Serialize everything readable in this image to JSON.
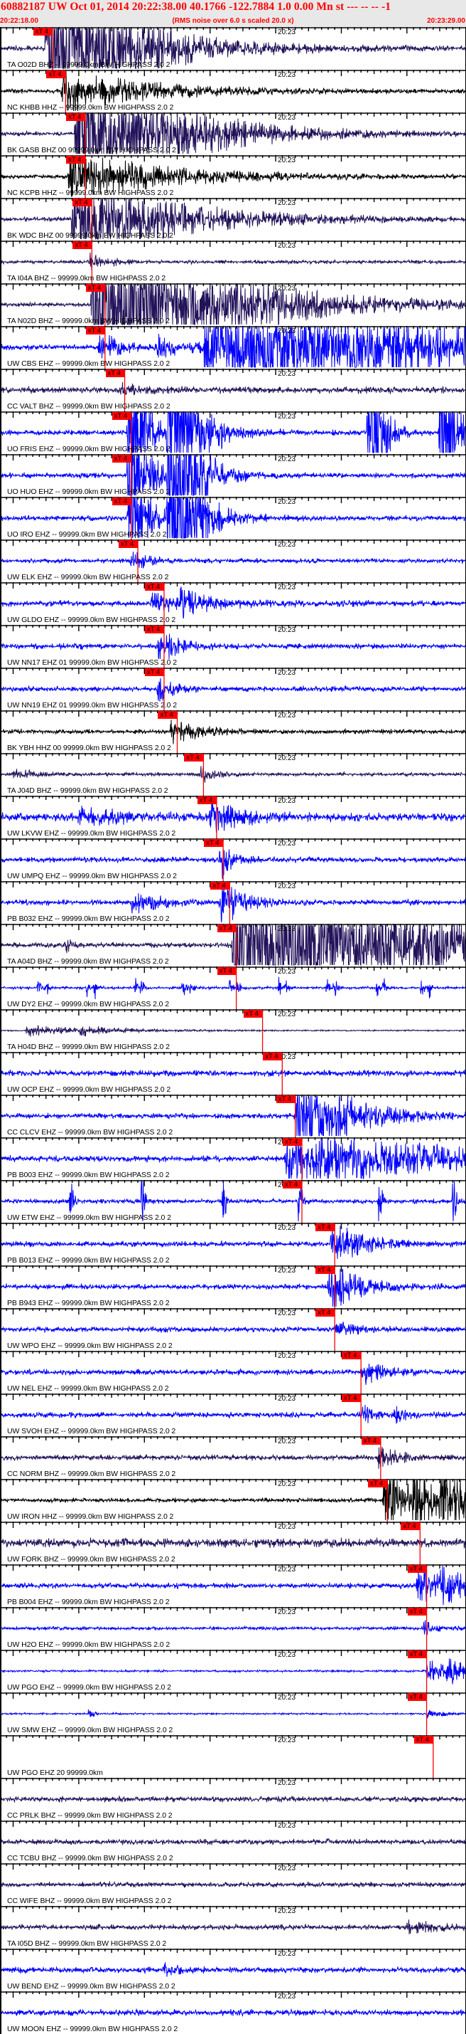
{
  "header": {
    "title": "60882187 UW Oct 01, 2014 20:22:38.00    40.1766 -122.7884  1.0 0.00 Mn st --- -- --  -1",
    "start_time": "20:22:18.00",
    "note": "(RMS noise over 6.0 s scaled 20.0 x)",
    "end_time": "20:23:29.00"
  },
  "colors": {
    "navy": "#22125a",
    "black": "#000000",
    "blue": "#0000ff",
    "pick": "#ff0000",
    "header_bg": "#e8e8e8"
  },
  "chart_data": {
    "type": "line",
    "title": "60882187 UW Oct 01, 2014 20:22:38.00",
    "x_range_s": [
      0,
      71
    ],
    "x_start": "20:22:18.00",
    "x_end": "20:23:29.00",
    "minute_mark_label": "20:23",
    "minute_mark_s": 42,
    "pick_label": "xT 4",
    "traces": [
      {
        "label": "TA O02D BHZ -- 99999.0km BW  HIGHPASS  2.0  2",
        "color": "navy",
        "noise": 0.12,
        "pick_s": 8,
        "events": [
          [
            7,
            6,
            10
          ]
        ]
      },
      {
        "label": "NC KHBB HHZ -- 99999.0km BW  HIGHPASS  2.0  2",
        "color": "black",
        "noise": 0.1,
        "pick_s": 10,
        "events": [
          [
            9.5,
            1.2,
            12
          ]
        ]
      },
      {
        "label": "BK GASB BHZ 00 99999.0km BW  HIGHPASS  2.0  2",
        "color": "navy",
        "noise": 0.1,
        "pick_s": 13,
        "events": [
          [
            11.5,
            5,
            12
          ]
        ]
      },
      {
        "label": "NC KCPB HHZ -- 99999.0km BW  HIGHPASS  2.0  2",
        "color": "black",
        "noise": 0.1,
        "pick_s": 13,
        "events": [
          [
            10.5,
            1.3,
            14
          ]
        ]
      },
      {
        "label": "BK WDC BHZ 00 99999.0km BW  HIGHPASS  2.0  2",
        "color": "navy",
        "noise": 0.1,
        "pick_s": 14,
        "events": [
          [
            11,
            2.5,
            14
          ]
        ]
      },
      {
        "label": "TA I04A BHZ -- 99999.0km BW  HIGHPASS  2.0  2",
        "color": "navy",
        "noise": 0.08,
        "pick_s": 14,
        "events": [
          [
            13.5,
            0.6,
            1.5
          ],
          [
            17,
            0.15,
            2
          ]
        ]
      },
      {
        "label": "TA N02D BHZ -- 99999.0km BW  HIGHPASS  2.0  2",
        "color": "navy",
        "noise": 0.1,
        "pick_s": 16,
        "events": [
          [
            14,
            6,
            15
          ]
        ]
      },
      {
        "label": "UW CBS EHZ -- 99999.0km BW  HIGHPASS  2.0  2",
        "color": "blue",
        "noise": 0.12,
        "pick_s": 16,
        "events": [
          [
            15,
            1.0,
            2.5
          ],
          [
            24,
            0.6,
            5
          ],
          [
            31,
            3,
            40
          ]
        ]
      },
      {
        "label": "CC VALT BHZ -- 99999.0km BW  HIGHPASS  2.0  2",
        "color": "navy",
        "noise": 0.15,
        "pick_s": 19,
        "events": [
          [
            18.5,
            0.4,
            2
          ]
        ]
      },
      {
        "label": "UO FRIS EHZ -- 99999.0km BW  HIGHPASS  2.0  2",
        "color": "blue",
        "noise": 0.12,
        "pick_s": 20,
        "events": [
          [
            19.5,
            6,
            2
          ],
          [
            25.5,
            10,
            3
          ],
          [
            56,
            10,
            1.5
          ],
          [
            67,
            10,
            1.5
          ]
        ]
      },
      {
        "label": "UO HUO EHZ -- 99999.0km BW  HIGHPASS  2.0  2",
        "color": "blue",
        "noise": 0.12,
        "pick_s": 20,
        "events": [
          [
            19.5,
            6,
            2
          ],
          [
            25.5,
            10,
            3
          ]
        ]
      },
      {
        "label": "UO IRO EHZ -- 99999.0km BW  HIGHPASS  2.0  2",
        "color": "blue",
        "noise": 0.12,
        "pick_s": 20,
        "events": [
          [
            19.5,
            6,
            2
          ],
          [
            25.5,
            10,
            3
          ]
        ]
      },
      {
        "label": "UW ELK EHZ -- 99999.0km BW  HIGHPASS  2.0  2",
        "color": "blue",
        "noise": 0.1,
        "pick_s": 21,
        "events": [
          [
            20,
            0.45,
            3
          ]
        ]
      },
      {
        "label": "UW GLDO EHZ -- 99999.0km BW  HIGHPASS  2.0  2",
        "color": "blue",
        "noise": 0.13,
        "pick_s": 25,
        "events": [
          [
            23,
            0.5,
            6
          ],
          [
            27,
            0.6,
            4
          ]
        ]
      },
      {
        "label": "UW NN17 EHZ 01 99999.0km BW  HIGHPASS  2.0  2",
        "color": "blue",
        "noise": 0.12,
        "pick_s": 25,
        "events": [
          [
            24,
            0.9,
            3
          ]
        ]
      },
      {
        "label": "UW NN19 EHZ 01 99999.0km BW  HIGHPASS  2.0  2",
        "color": "blue",
        "noise": 0.12,
        "pick_s": 25,
        "events": [
          [
            24,
            0.8,
            2
          ]
        ]
      },
      {
        "label": "BK YBH HHZ 00 99999.0km BW  HIGHPASS  2.0  2",
        "color": "black",
        "noise": 0.1,
        "pick_s": 27,
        "events": [
          [
            26,
            0.7,
            4
          ]
        ]
      },
      {
        "label": "TA J04D BHZ -- 99999.0km BW  HIGHPASS  2.0  2",
        "color": "navy",
        "noise": 0.08,
        "pick_s": 31,
        "events": [
          [
            2,
            0.3,
            3
          ],
          [
            30.5,
            0.5,
            2
          ]
        ]
      },
      {
        "label": "UW LKVW EHZ -- 99999.0km BW  HIGHPASS  2.0  2",
        "color": "blue",
        "noise": 0.18,
        "pick_s": 33,
        "events": [
          [
            12,
            0.4,
            8
          ],
          [
            32,
            0.9,
            4
          ]
        ]
      },
      {
        "label": "UW UMPQ EHZ -- 99999.0km BW  HIGHPASS  2.0  2",
        "color": "blue",
        "noise": 0.12,
        "pick_s": 34,
        "events": [
          [
            33.5,
            1.2,
            1.5
          ]
        ]
      },
      {
        "label": "PB B032 EHZ -- 99999.0km BW  HIGHPASS  2.0  2",
        "color": "blue",
        "noise": 0.12,
        "pick_s": 35,
        "events": [
          [
            20,
            0.6,
            4
          ],
          [
            33.5,
            1.5,
            3
          ]
        ]
      },
      {
        "label": "TA A04D BHZ -- 99999.0km BW  HIGHPASS  2.0  2",
        "color": "navy",
        "noise": 0.12,
        "pick_s": 36,
        "events": [
          [
            9.6,
            0.5,
            1
          ],
          [
            35.5,
            4,
            40
          ]
        ]
      },
      {
        "label": "UW DY2 EHZ -- 99999.0km BW  HIGHPASS  2.0  2",
        "color": "blue",
        "noise": 0.06,
        "pick_s": 36,
        "events": [
          [
            5.7,
            0.9,
            0.3
          ],
          [
            7,
            0.9,
            0.3
          ],
          [
            13.2,
            0.9,
            0.3
          ],
          [
            14.4,
            0.9,
            0.3
          ],
          [
            20.5,
            0.9,
            0.3
          ],
          [
            21.5,
            0.9,
            0.3
          ],
          [
            27.8,
            0.9,
            0.3
          ],
          [
            28.9,
            0.9,
            0.3
          ],
          [
            35,
            0.9,
            0.3
          ],
          [
            36.2,
            0.9,
            0.3
          ],
          [
            42.4,
            0.9,
            0.3
          ],
          [
            43.5,
            0.9,
            0.3
          ],
          [
            49.8,
            0.9,
            0.3
          ],
          [
            50.9,
            0.9,
            0.3
          ],
          [
            57.3,
            0.9,
            0.3
          ],
          [
            58.3,
            0.9,
            0.3
          ],
          [
            64.2,
            0.9,
            0.3
          ],
          [
            65.3,
            0.9,
            0.3
          ]
        ]
      },
      {
        "label": "TA H04D BHZ -- 99999.0km BW  HIGHPASS  2.0  2",
        "color": "navy",
        "noise": 0.03,
        "pick_s": 40,
        "events": [
          [
            4,
            0.3,
            8
          ],
          [
            12,
            0.2,
            6
          ]
        ]
      },
      {
        "label": "UW OCP EHZ -- 99999.0km BW  HIGHPASS  2.0  2",
        "color": "blue",
        "noise": 0.14,
        "pick_s": 43,
        "events": []
      },
      {
        "label": "CC CLCV EHZ -- 99999.0km BW  HIGHPASS  2.0  2",
        "color": "blue",
        "noise": 0.12,
        "pick_s": 45,
        "events": [
          [
            45,
            4,
            6
          ]
        ]
      },
      {
        "label": "PB B003 EHZ -- 99999.0km BW  HIGHPASS  2.0  2",
        "color": "blue",
        "noise": 0.14,
        "pick_s": 46,
        "events": [
          [
            43.5,
            1.4,
            25
          ]
        ]
      },
      {
        "label": "UW ETW EHZ -- 99999.0km BW  HIGHPASS  2.0  2",
        "color": "blue",
        "noise": 0.1,
        "pick_s": 46,
        "events": [
          [
            10.7,
            3,
            0.3
          ],
          [
            21.6,
            3,
            0.3
          ],
          [
            33.9,
            3,
            0.3
          ],
          [
            45.5,
            3,
            0.3
          ],
          [
            57.7,
            3,
            0.3
          ],
          [
            69,
            3,
            0.3
          ]
        ]
      },
      {
        "label": "PB B013 EHZ -- 99999.0km BW  HIGHPASS  2.0  2",
        "color": "blue",
        "noise": 0.12,
        "pick_s": 51,
        "events": [
          [
            50.5,
            1.4,
            4
          ]
        ]
      },
      {
        "label": "PB B943 EHZ -- 99999.0km BW  HIGHPASS  2.0  2",
        "color": "blue",
        "noise": 0.12,
        "pick_s": 51,
        "events": [
          [
            50,
            1.4,
            4
          ]
        ]
      },
      {
        "label": "UW WPO EHZ -- 99999.0km BW  HIGHPASS  2.0  2",
        "color": "blue",
        "noise": 0.12,
        "pick_s": 51,
        "events": [
          [
            51,
            0.4,
            3
          ]
        ]
      },
      {
        "label": "UW NEL EHZ -- 99999.0km BW  HIGHPASS  2.0  2",
        "color": "blue",
        "noise": 0.12,
        "pick_s": 55,
        "events": [
          [
            55,
            0.7,
            3
          ]
        ]
      },
      {
        "label": "UW SVOH EHZ -- 99999.0km BW  HIGHPASS  2.0  2",
        "color": "blue",
        "noise": 0.12,
        "pick_s": 55,
        "events": [
          [
            55,
            0.5,
            2
          ],
          [
            60,
            0.4,
            2
          ]
        ]
      },
      {
        "label": "CC NORM BHZ -- 99999.0km BW  HIGHPASS  2.0  2",
        "color": "navy",
        "noise": 0.12,
        "pick_s": 58,
        "events": [
          [
            57.5,
            0.6,
            3
          ]
        ]
      },
      {
        "label": "UW IRON HHZ -- 99999.0km BW  HIGHPASS  2.0  2",
        "color": "black",
        "noise": 0.1,
        "pick_s": 59,
        "events": [
          [
            58.5,
            3,
            3
          ],
          [
            63,
            3,
            2
          ],
          [
            67,
            3,
            3
          ]
        ]
      },
      {
        "label": "UW FORK BHZ -- 99999.0km BW  HIGHPASS  2.0  2",
        "color": "navy",
        "noise": 0.2,
        "pick_s": 64,
        "events": []
      },
      {
        "label": "PB B004 EHZ -- 99999.0km BW  HIGHPASS  2.0  2",
        "color": "blue",
        "noise": 0.12,
        "pick_s": 65,
        "events": [
          [
            63.5,
            1.0,
            4
          ],
          [
            67,
            1.0,
            3
          ]
        ]
      },
      {
        "label": "UW H2O EHZ -- 99999.0km BW  HIGHPASS  2.0  2",
        "color": "blue",
        "noise": 0.08,
        "pick_s": 65,
        "events": [
          [
            64.5,
            0.4,
            2
          ]
        ]
      },
      {
        "label": "UW PGO EHZ -- 99999.0km BW  HIGHPASS  2.0  2",
        "color": "blue",
        "noise": 0.05,
        "pick_s": 65,
        "events": [
          [
            65,
            0.6,
            4
          ],
          [
            68,
            0.6,
            3
          ]
        ]
      },
      {
        "label": "UW SMW EHZ -- 99999.0km BW  HIGHPASS  2.0  2",
        "color": "blue",
        "noise": 0.04,
        "pick_s": 65,
        "events": [
          [
            13.5,
            0.5,
            0.6
          ],
          [
            65,
            0.3,
            2
          ]
        ]
      },
      {
        "label": "UW PGO EHZ 20 99999.0km",
        "color": "blue",
        "noise": 0,
        "pick_s": 66,
        "events": [],
        "empty": true
      },
      {
        "label": "CC PRLK BHZ -- 99999.0km BW  HIGHPASS  2.0  2",
        "color": "navy",
        "noise": 0.12,
        "pick_s": null,
        "events": []
      },
      {
        "label": "CC TCBU BHZ -- 99999.0km BW  HIGHPASS  2.0  2",
        "color": "navy",
        "noise": 0.12,
        "pick_s": null,
        "events": []
      },
      {
        "label": "CC WIFE BHZ -- 99999.0km BW  HIGHPASS  2.0  2",
        "color": "navy",
        "noise": 0.11,
        "pick_s": null,
        "events": []
      },
      {
        "label": "TA I05D BHZ -- 99999.0km BW  HIGHPASS  2.0  2",
        "color": "navy",
        "noise": 0.12,
        "pick_s": null,
        "events": [
          [
            62,
            0.3,
            5
          ]
        ]
      },
      {
        "label": "UW BEND EHZ -- 99999.0km BW  HIGHPASS  2.0  2",
        "color": "blue",
        "noise": 0.13,
        "pick_s": null,
        "events": [
          [
            25,
            0.4,
            2
          ]
        ]
      },
      {
        "label": "UW MOON EHZ -- 99999.0km BW  HIGHPASS  2.0  2",
        "color": "blue",
        "noise": 0.13,
        "pick_s": null,
        "events": []
      }
    ]
  }
}
